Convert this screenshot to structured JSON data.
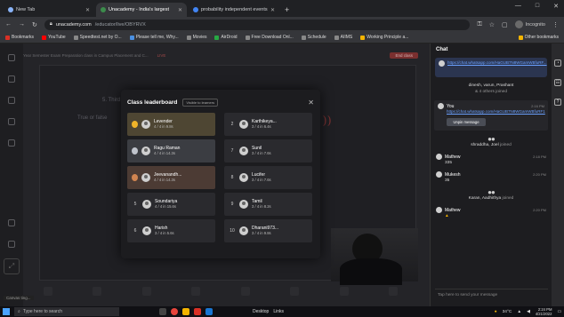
{
  "browser": {
    "tabs": [
      {
        "label": "New Tab",
        "active": false,
        "icon_color": "#8ab4f8"
      },
      {
        "label": "Unacademy - India's largest",
        "active": true,
        "icon_color": "#3c8c4c"
      },
      {
        "label": "probability independent events",
        "active": false,
        "icon_color": "#4285f4"
      }
    ],
    "new_tab_glyph": "+",
    "window_controls": [
      "—",
      "□",
      "✕"
    ],
    "url_domain": "unacademy.com",
    "url_path": "/educator/live/OBYRVX",
    "incognito_label": "Incognito"
  },
  "bookmarks": {
    "items": [
      "Bookmarks",
      "YouTube",
      "Speedtest.net by O...",
      "Please tell me, Why...",
      "Movies",
      "AirDroid",
      "Free Download Onl...",
      "Schedule",
      "AIIMS",
      "Working Principle a..."
    ],
    "other": "Other bookmarks"
  },
  "page": {
    "session_title": "Year Semester Exam Preparation class in Campus Placement and C...",
    "top_strip_red": "LIVE",
    "top_strip_btn": "End class",
    "board_lines": [
      "5. Third year",
      "True or false"
    ]
  },
  "leaderboard": {
    "title": "Class leaderboard",
    "visibility": "Visible to learners",
    "close_glyph": "✕",
    "entries": [
      {
        "rank": "1",
        "name": "Levender",
        "score": "4 / 4 in 9.8s",
        "tone": "gold"
      },
      {
        "rank": "2",
        "name": "Karthikeya...",
        "score": "3 / 4 in 6.4s",
        "tone": "plain"
      },
      {
        "rank": "3",
        "name": "Ragu Raman",
        "score": "4 / 4 in 14.3s",
        "tone": "silver"
      },
      {
        "rank": "7",
        "name": "Sunil",
        "score": "3 / 4 in 7.6s",
        "tone": "plain"
      },
      {
        "rank": "4",
        "name": "Jeevanandh...",
        "score": "4 / 4 in 14.3s",
        "tone": "bronze"
      },
      {
        "rank": "8",
        "name": "Lucifer",
        "score": "3 / 4 in 7.6s",
        "tone": "plain"
      },
      {
        "rank": "5",
        "name": "Soundariya",
        "score": "4 / 4 in 15.6s",
        "tone": "plain"
      },
      {
        "rank": "9",
        "name": "Tamil",
        "score": "3 / 4 in 8.2s",
        "tone": "plain"
      },
      {
        "rank": "6",
        "name": "Harish",
        "score": "3 / 4 in 5.6s",
        "tone": "plain"
      },
      {
        "rank": "10",
        "name": "Dharani973...",
        "score": "3 / 4 in 9.8s",
        "tone": "plain"
      }
    ]
  },
  "chat": {
    "title": "Chat",
    "pinned_link": "https://chat.whatsapp.com/HaGUB7N8WGamWBfuRF...",
    "joined1_names": "dinesh, varun, Prashant",
    "joined1_sub": "& 4 others joined",
    "you_label": "You",
    "you_time": "2:16 PM",
    "you_link": "https://chat.whatsapp.com/HaGUB7N8WGamWBfuRF1",
    "unpin_label": "Unpin message",
    "joined2": "shraddha, Joel",
    "joined2_suffix": " joined",
    "messages": [
      {
        "name": "Mathew",
        "time": "2:18 PM",
        "text": "335"
      },
      {
        "name": "Mukesh",
        "time": "2:20 PM",
        "text": "35"
      }
    ],
    "joined3": "Karan, Aadhithya",
    "joined3_suffix": " joined",
    "last_name": "Mathew",
    "last_time": "2:20 PM",
    "input_placeholder": "Tap here to send your message"
  },
  "taskbar": {
    "search_placeholder": "Type here to search",
    "desktop_label": "Desktop",
    "links_label": "Links",
    "weather": "34°C",
    "time": "2:24 PM",
    "date": "4/21/2022",
    "corner_text": "Canvas ting..."
  }
}
